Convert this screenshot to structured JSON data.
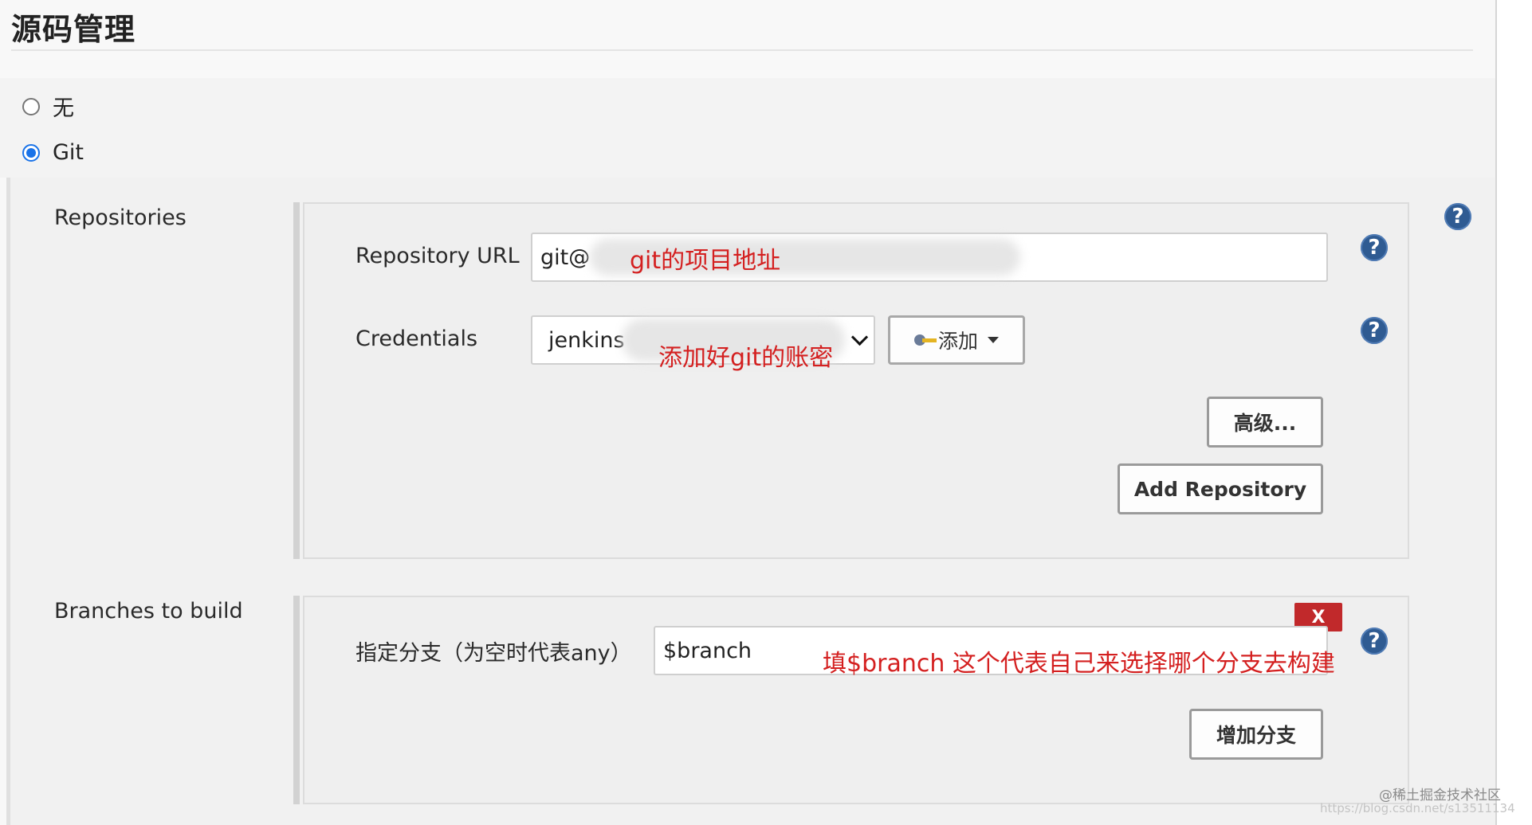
{
  "section": {
    "title": "源码管理"
  },
  "scm_options": [
    {
      "label": "无",
      "selected": false
    },
    {
      "label": "Git",
      "selected": true
    }
  ],
  "repositories": {
    "label": "Repositories",
    "url_label": "Repository URL",
    "url_value": "git@",
    "url_annotation": "git的项目地址",
    "credentials_label": "Credentials",
    "credentials_value": "jenkins",
    "credentials_annotation": "添加好git的账密",
    "add_button": "添加",
    "advanced_button": "高级...",
    "add_repository_button": "Add Repository"
  },
  "branches": {
    "label": "Branches to build",
    "spec_label": "指定分支（为空时代表any）",
    "spec_value": "$branch",
    "annotation": "填$branch 这个代表自己来选择哪个分支去构建",
    "delete_label": "X",
    "add_branch_button": "增加分支"
  },
  "help_symbol": "?",
  "icons": {
    "help": "question-circle-icon",
    "credentials_add": "key-icon",
    "dropdown": "chevron-down-icon"
  },
  "colors": {
    "help": "#2f5b92",
    "delete": "#c1292b",
    "annotation": "#d42020",
    "radio_accent": "#1a73e8"
  },
  "watermark": {
    "main": "@稀土掘金技术社区",
    "faint": "https://blog.csdn.net/s13511134"
  }
}
